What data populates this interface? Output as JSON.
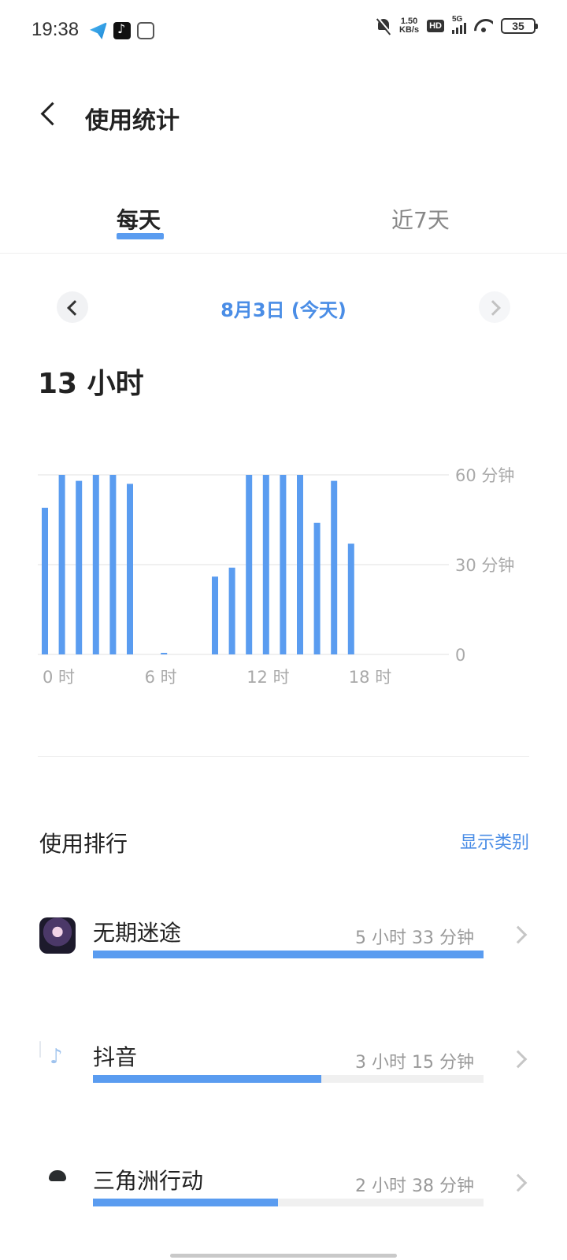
{
  "status_bar": {
    "time": "19:38",
    "net_speed_value": "1.50",
    "net_speed_unit": "KB/s",
    "hd": "HD",
    "network": "5G",
    "battery": "35"
  },
  "header": {
    "title": "使用统计"
  },
  "tabs": [
    {
      "label": "每天",
      "selected": true
    },
    {
      "label": "近7天",
      "selected": false
    }
  ],
  "date_nav": {
    "label": "8月3日 (今天)"
  },
  "summary": {
    "total": "13 小时"
  },
  "chart_data": {
    "type": "bar",
    "x": [
      0,
      1,
      2,
      3,
      4,
      5,
      6,
      7,
      8,
      9,
      10,
      11,
      12,
      13,
      14,
      15,
      16,
      17,
      18,
      19,
      20,
      21,
      22,
      23
    ],
    "values": [
      49,
      60,
      58,
      60,
      60,
      57,
      0,
      0.5,
      0,
      0,
      26,
      29,
      60,
      60,
      60,
      60,
      44,
      58,
      37,
      0,
      0,
      0,
      0,
      0
    ],
    "x_tick_labels": [
      "0 时",
      "6 时",
      "12 时",
      "18 时"
    ],
    "y_tick_labels": [
      "60 分钟",
      "30 分钟",
      "0"
    ],
    "ylim": [
      0,
      60
    ],
    "grid": true,
    "bar_color": "#5a9cf0"
  },
  "ranking": {
    "title": "使用排行",
    "show_category": "显示类别",
    "items": [
      {
        "icon": "wuqi-app-icon",
        "name": "无期迷途",
        "duration": "5 小时 33 分钟",
        "fraction": 1.0
      },
      {
        "icon": "douyin-app-icon",
        "name": "抖音",
        "duration": "3 小时 15 分钟",
        "fraction": 0.585
      },
      {
        "icon": "sanjiaozhou-app-icon",
        "name": "三角洲行动",
        "duration": "2 小时 38 分钟",
        "fraction": 0.474
      }
    ]
  },
  "colors": {
    "accent": "#5a9cf0",
    "accent_text": "#4a8de6"
  }
}
